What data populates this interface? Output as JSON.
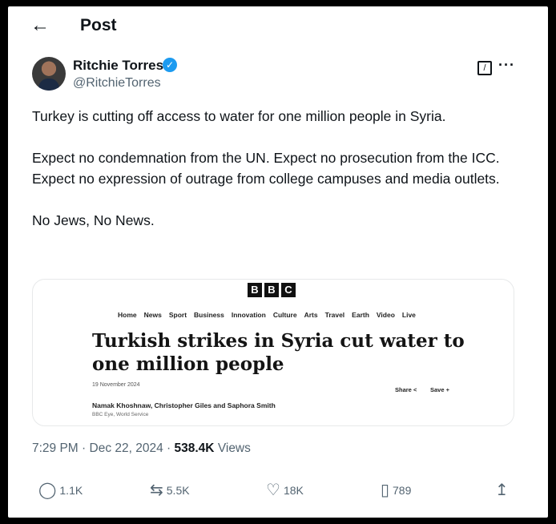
{
  "header": {
    "back_icon": "arrow-left-icon",
    "title": "Post"
  },
  "author": {
    "name": "Ritchie Torres",
    "handle": "@RitchieTorres",
    "verified_color": "#1d9bf0"
  },
  "tweet": {
    "line1": "Turkey is cutting off access to water for one million people in Syria.",
    "line2": "Expect no condemnation from the UN.   Expect no prosecution from the ICC.",
    "line3": "Expect no expression of outrage from college campuses and media outlets.",
    "line4": "No Jews, No News."
  },
  "card": {
    "logo": [
      "B",
      "B",
      "C"
    ],
    "nav": [
      "Home",
      "News",
      "Sport",
      "Business",
      "Innovation",
      "Culture",
      "Arts",
      "Travel",
      "Earth",
      "Video",
      "Live"
    ],
    "headline": "Turkish strikes in Syria cut water to one million people",
    "date": "19 November 2024",
    "share_label": "Share",
    "save_label": "Save",
    "byline": "Namak Khoshnaw, Christopher Giles and Saphora Smith",
    "byline_sub": "BBC Eye, World Service"
  },
  "meta": {
    "time": "7:29 PM",
    "sep": " · ",
    "date": "Dec 22, 2024",
    "views_count": "538.4K",
    "views_label": "Views"
  },
  "actions": {
    "replies": "1.1K",
    "reposts": "5.5K",
    "likes": "18K",
    "bookmarks": "789"
  }
}
